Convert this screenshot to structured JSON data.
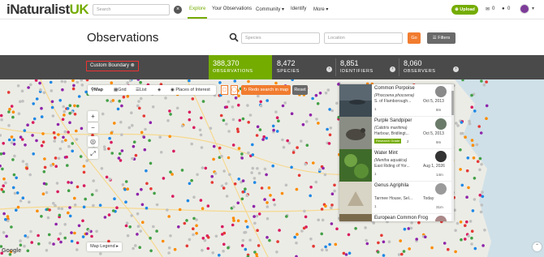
{
  "nav": {
    "logo_part1": "iNaturalist",
    "logo_part2": "UK",
    "search_placeholder": "Search",
    "links": [
      "Explore",
      "Your Observations",
      "Community ▾",
      "Identify",
      "More ▾"
    ],
    "upload_label": "⊕ Upload",
    "mail_count": "0",
    "chat_count": "0"
  },
  "header": {
    "title": "Observations",
    "species_placeholder": "Species",
    "location_placeholder": "Location",
    "go_label": "Go",
    "filters_label": "Filters"
  },
  "stats": {
    "boundary_label": "Custom Boundary",
    "items": [
      {
        "value": "388,370",
        "label": "OBSERVATIONS"
      },
      {
        "value": "8,472",
        "label": "SPECIES"
      },
      {
        "value": "8,851",
        "label": "IDENTIFIERS"
      },
      {
        "value": "8,060",
        "label": "OBSERVERS"
      }
    ]
  },
  "map": {
    "tabs": [
      "Map",
      "Grid",
      "List"
    ],
    "places_label": "Places of Interest",
    "redo_label": "Redo search in map",
    "reset_label": "Reset",
    "legend_label": "Map Legend ▸",
    "google_label": "Google",
    "observations": [
      {
        "name": "Common Porpoise",
        "sci": "(Phocoena phocoena)",
        "location": "S. of Flamborough...",
        "date": "Oct 5, 2013",
        "ids": "1",
        "time": "8m"
      },
      {
        "name": "Purple Sandpiper",
        "sci": "(Calidris maritima)",
        "location": "Harbour, Bridlingt...",
        "date": "Oct 5, 2013",
        "badge": "Research Grade",
        "ids": "2",
        "time": "9m"
      },
      {
        "name": "Water Mint",
        "sci": "(Mentha aquatica)",
        "location": "East Riding of Yor...",
        "date": "Aug 1, 2026",
        "ids": "1",
        "time": "14m"
      },
      {
        "name": "Genus Agriphila",
        "sci": "",
        "location": "Tarrnee House, Sel...",
        "date": "Today",
        "ids": "1",
        "time": "31m"
      },
      {
        "name": "European Common Frog",
        "sci": "",
        "location": "",
        "date": "",
        "ids": "",
        "time": ""
      }
    ]
  },
  "colors": {
    "brand_green": "#74ac00",
    "accent_orange": "#f17c2f",
    "stats_bg": "#4a4a4a"
  }
}
